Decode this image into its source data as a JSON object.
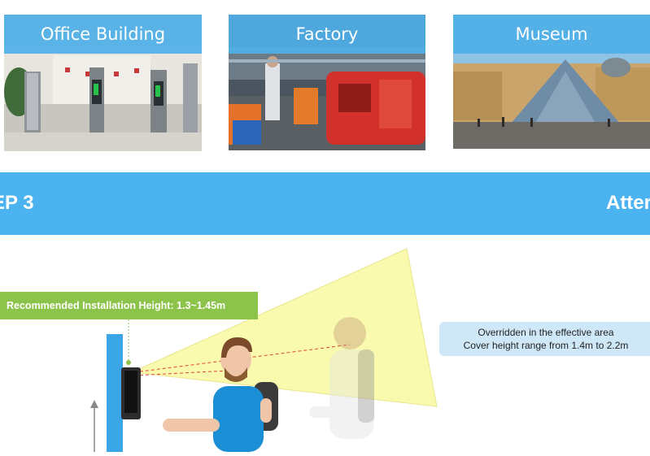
{
  "cards": [
    {
      "caption": "Office Building",
      "scene": "office-turnstile-photo"
    },
    {
      "caption": "Factory",
      "scene": "factory-assembly-line-photo"
    },
    {
      "caption": "Museum",
      "scene": "louvre-pyramid-photo"
    }
  ],
  "step_band": {
    "left_text": "EP 3",
    "right_text": "Atter"
  },
  "diagram": {
    "height_label": "Recommended Installation Height: 1.3~1.45m",
    "note_line1": "Overridden in the effective area",
    "note_line2": "Cover height range from 1.4m to 2.2m"
  },
  "colors": {
    "accent_blue": "#4bb3ef",
    "label_green": "#8cc34a",
    "cone_yellow": "#fafaa0"
  }
}
